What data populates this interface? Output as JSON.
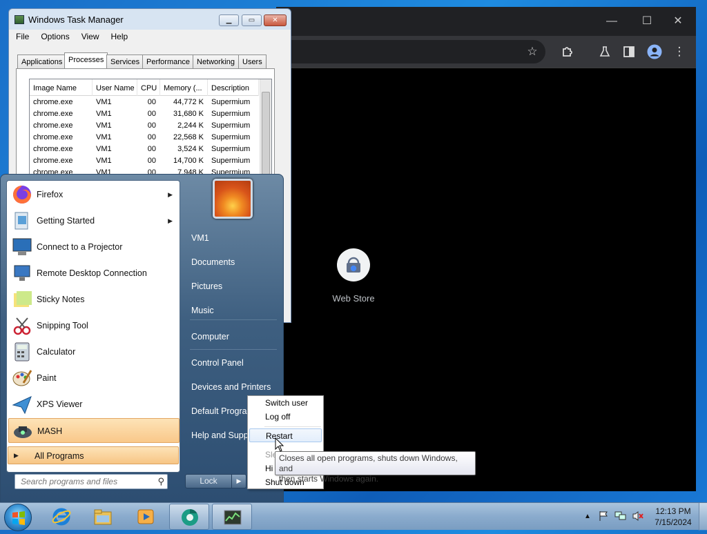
{
  "chrome": {
    "min_icon": "minimize-icon",
    "max_icon": "maximize-icon",
    "close_icon": "close-icon",
    "toolbar_icons": [
      "star-icon",
      "extensions-icon",
      "labs-icon",
      "side-panel-icon",
      "profile-icon",
      "menu-icon"
    ],
    "webstore_label": "Web Store"
  },
  "taskmgr": {
    "title": "Windows Task Manager",
    "menu": [
      "File",
      "Options",
      "View",
      "Help"
    ],
    "tabs": [
      "Applications",
      "Processes",
      "Services",
      "Performance",
      "Networking",
      "Users"
    ],
    "active_tab": "Processes",
    "columns": [
      "Image Name",
      "User Name",
      "CPU",
      "Memory (...",
      "Description"
    ],
    "rows": [
      [
        "chrome.exe",
        "VM1",
        "00",
        "44,772 K",
        "Supermium"
      ],
      [
        "chrome.exe",
        "VM1",
        "00",
        "31,680 K",
        "Supermium"
      ],
      [
        "chrome.exe",
        "VM1",
        "00",
        "2,244 K",
        "Supermium"
      ],
      [
        "chrome.exe",
        "VM1",
        "00",
        "22,568 K",
        "Supermium"
      ],
      [
        "chrome.exe",
        "VM1",
        "00",
        "3,524 K",
        "Supermium"
      ],
      [
        "chrome.exe",
        "VM1",
        "00",
        "14,700 K",
        "Supermium"
      ],
      [
        "chrome.exe",
        "VM1",
        "00",
        "7,948 K",
        "Supermium"
      ]
    ]
  },
  "startmenu": {
    "programs": [
      {
        "label": "Firefox",
        "icon": "firefox-icon",
        "submenu": true
      },
      {
        "label": "Getting Started",
        "icon": "getting-started-icon",
        "submenu": true
      },
      {
        "label": "Connect to a Projector",
        "icon": "projector-icon",
        "submenu": false
      },
      {
        "label": "Remote Desktop Connection",
        "icon": "remote-desktop-icon",
        "submenu": false
      },
      {
        "label": "Sticky Notes",
        "icon": "sticky-notes-icon",
        "submenu": false
      },
      {
        "label": "Snipping Tool",
        "icon": "snipping-tool-icon",
        "submenu": false
      },
      {
        "label": "Calculator",
        "icon": "calculator-icon",
        "submenu": false
      },
      {
        "label": "Paint",
        "icon": "paint-icon",
        "submenu": false
      },
      {
        "label": "XPS Viewer",
        "icon": "xps-viewer-icon",
        "submenu": false
      },
      {
        "label": "MASH",
        "icon": "mash-icon",
        "submenu": false
      }
    ],
    "all_programs": "All Programs",
    "search_placeholder": "Search programs and files",
    "right_links": [
      "VM1",
      "Documents",
      "Pictures",
      "Music",
      "Computer",
      "Control Panel",
      "Devices and Printers",
      "Default Programs",
      "Help and Support"
    ],
    "lock_label": "Lock"
  },
  "power_menu": {
    "items": [
      "Switch user",
      "Log off",
      "Restart",
      "Sleep",
      "Hibernate",
      "Shut down"
    ],
    "visible_text": [
      "Switch user",
      "Log off",
      "Restart",
      "Sle",
      "Hi",
      "Shut down"
    ],
    "highlighted": "Restart"
  },
  "tooltip": {
    "line1": "Closes all open programs, shuts down Windows, and",
    "line2": "then starts Windows again."
  },
  "taskbar": {
    "pinned": [
      "internet-explorer-icon",
      "explorer-icon",
      "media-player-icon",
      "chrome-icon",
      "task-manager-icon"
    ],
    "time": "12:13 PM",
    "date": "7/15/2024"
  },
  "colors": {
    "highlight": "#f9c88a",
    "chrome_bg": "#202124",
    "startmenu_right": "#3e5f80"
  }
}
